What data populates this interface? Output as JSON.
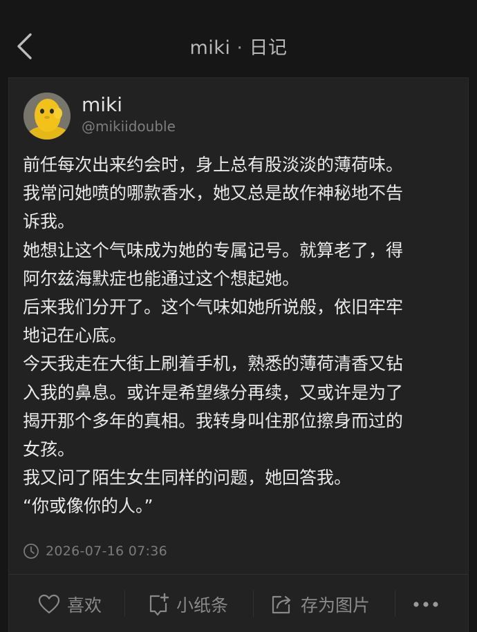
{
  "nav": {
    "title": "miki",
    "separator": "·",
    "subtitle": "日记"
  },
  "post": {
    "author_name": "miki",
    "author_handle": "@mikiidouble",
    "lines": [
      "前任每次出来约会时，身上总有股淡淡的薄荷味。",
      "我常问她喷的哪款香水，她又总是故作神秘地不告",
      "诉我。",
      "她想让这个气味成为她的专属记号。就算老了，得",
      "阿尔兹海默症也能通过这个想起她。",
      "后来我们分开了。这个气味如她所说般，依旧牢牢",
      "地记在心底。",
      "今天我走在大街上刷着手机，熟悉的薄荷清香又钻",
      "入我的鼻息。或许是希望缘分再续，又或许是为了",
      "揭开那个多年的真相。我转身叫住那位擦身而过的",
      "女孩。",
      "我又问了陌生女生同样的问题，她回答我。",
      "“你或像你的人。”"
    ],
    "timestamp": "2026-07-16 07:36"
  },
  "actions": {
    "like": "喜欢",
    "note": "小纸条",
    "save_image": "存为图片"
  },
  "icons": {
    "back": "chevron-left-icon",
    "clock": "clock-icon",
    "like": "heart-icon",
    "note": "note-add-icon",
    "save_image": "share-box-icon",
    "more": "more-dots-icon"
  },
  "colors": {
    "background": "#161616",
    "card": "#222222",
    "text": "#e9e9e9",
    "muted": "#7b7b7b",
    "avatar_yellow": "#f2c21a"
  }
}
